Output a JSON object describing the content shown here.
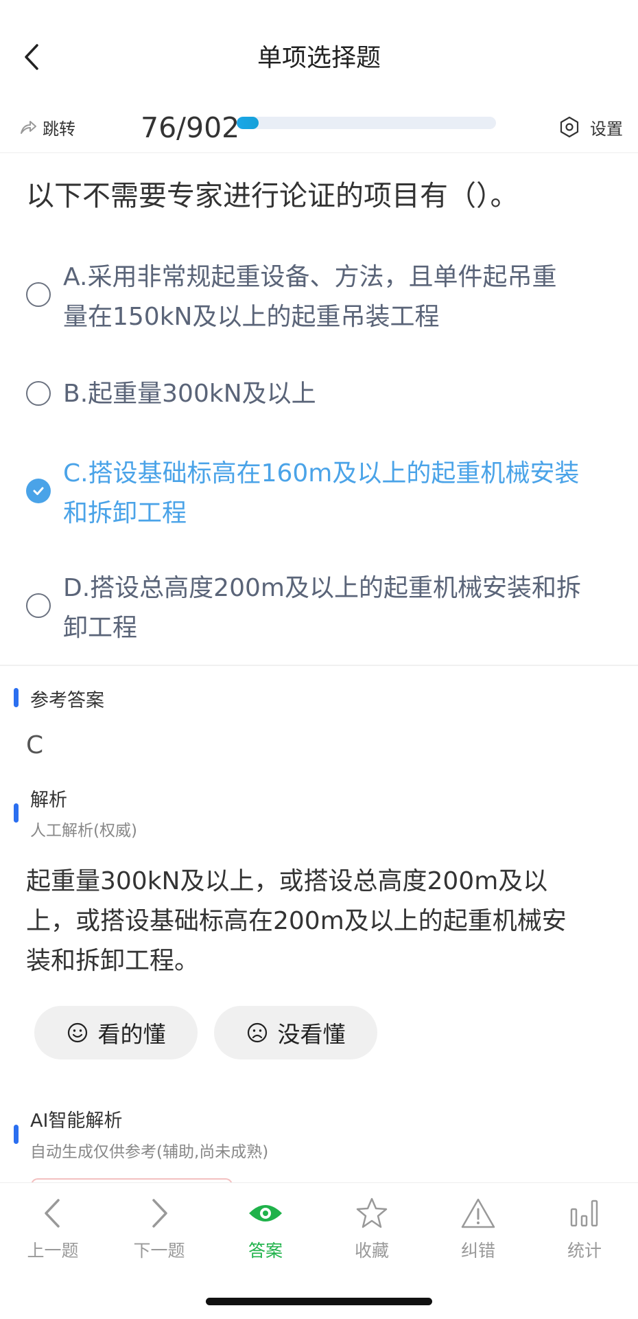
{
  "header": {
    "title": "单项选择题"
  },
  "toolbar": {
    "jump_label": "跳转",
    "progress_text": "76/902",
    "progress_fraction": 0.084,
    "settings_label": "设置"
  },
  "question": {
    "text": "以下不需要专家进行论证的项目有（）。"
  },
  "options": [
    {
      "line1": "A.采用非常规起重设备、方法，且单件起吊重",
      "line2": "量在150kN及以上的起重吊装工程",
      "selected": false
    },
    {
      "line1": "B.起重量300kN及以上",
      "line2": "",
      "selected": false
    },
    {
      "line1": "C.搭设基础标高在160m及以上的起重机械安装",
      "line2": "和拆卸工程",
      "selected": true
    },
    {
      "line1": "D.搭设总高度200m及以上的起重机械安装和拆",
      "line2": "卸工程",
      "selected": false
    }
  ],
  "reference": {
    "title": "参考答案",
    "answer": "C"
  },
  "analysis": {
    "title": "解析",
    "subtitle": "人工解析(权威)",
    "line1": "起重量300kN及以上，或搭设总高度200m及以",
    "line2": "上，或搭设基础标高在200m及以上的起重机械安",
    "line3": "装和拆卸工程。"
  },
  "feedback": {
    "understood": "看的懂",
    "not_understood": "没看懂"
  },
  "ai": {
    "title": "AI智能解析",
    "subtitle": "自动生成仅供参考(辅助,尚未成熟)"
  },
  "nav": [
    {
      "label": "上一题"
    },
    {
      "label": "下一题"
    },
    {
      "label": "答案"
    },
    {
      "label": "收藏"
    },
    {
      "label": "纠错"
    },
    {
      "label": "统计"
    }
  ],
  "colors": {
    "accent_blue": "#4aa3e8",
    "nav_active_green": "#1fb24a",
    "section_bar": "#2b6ff0"
  }
}
